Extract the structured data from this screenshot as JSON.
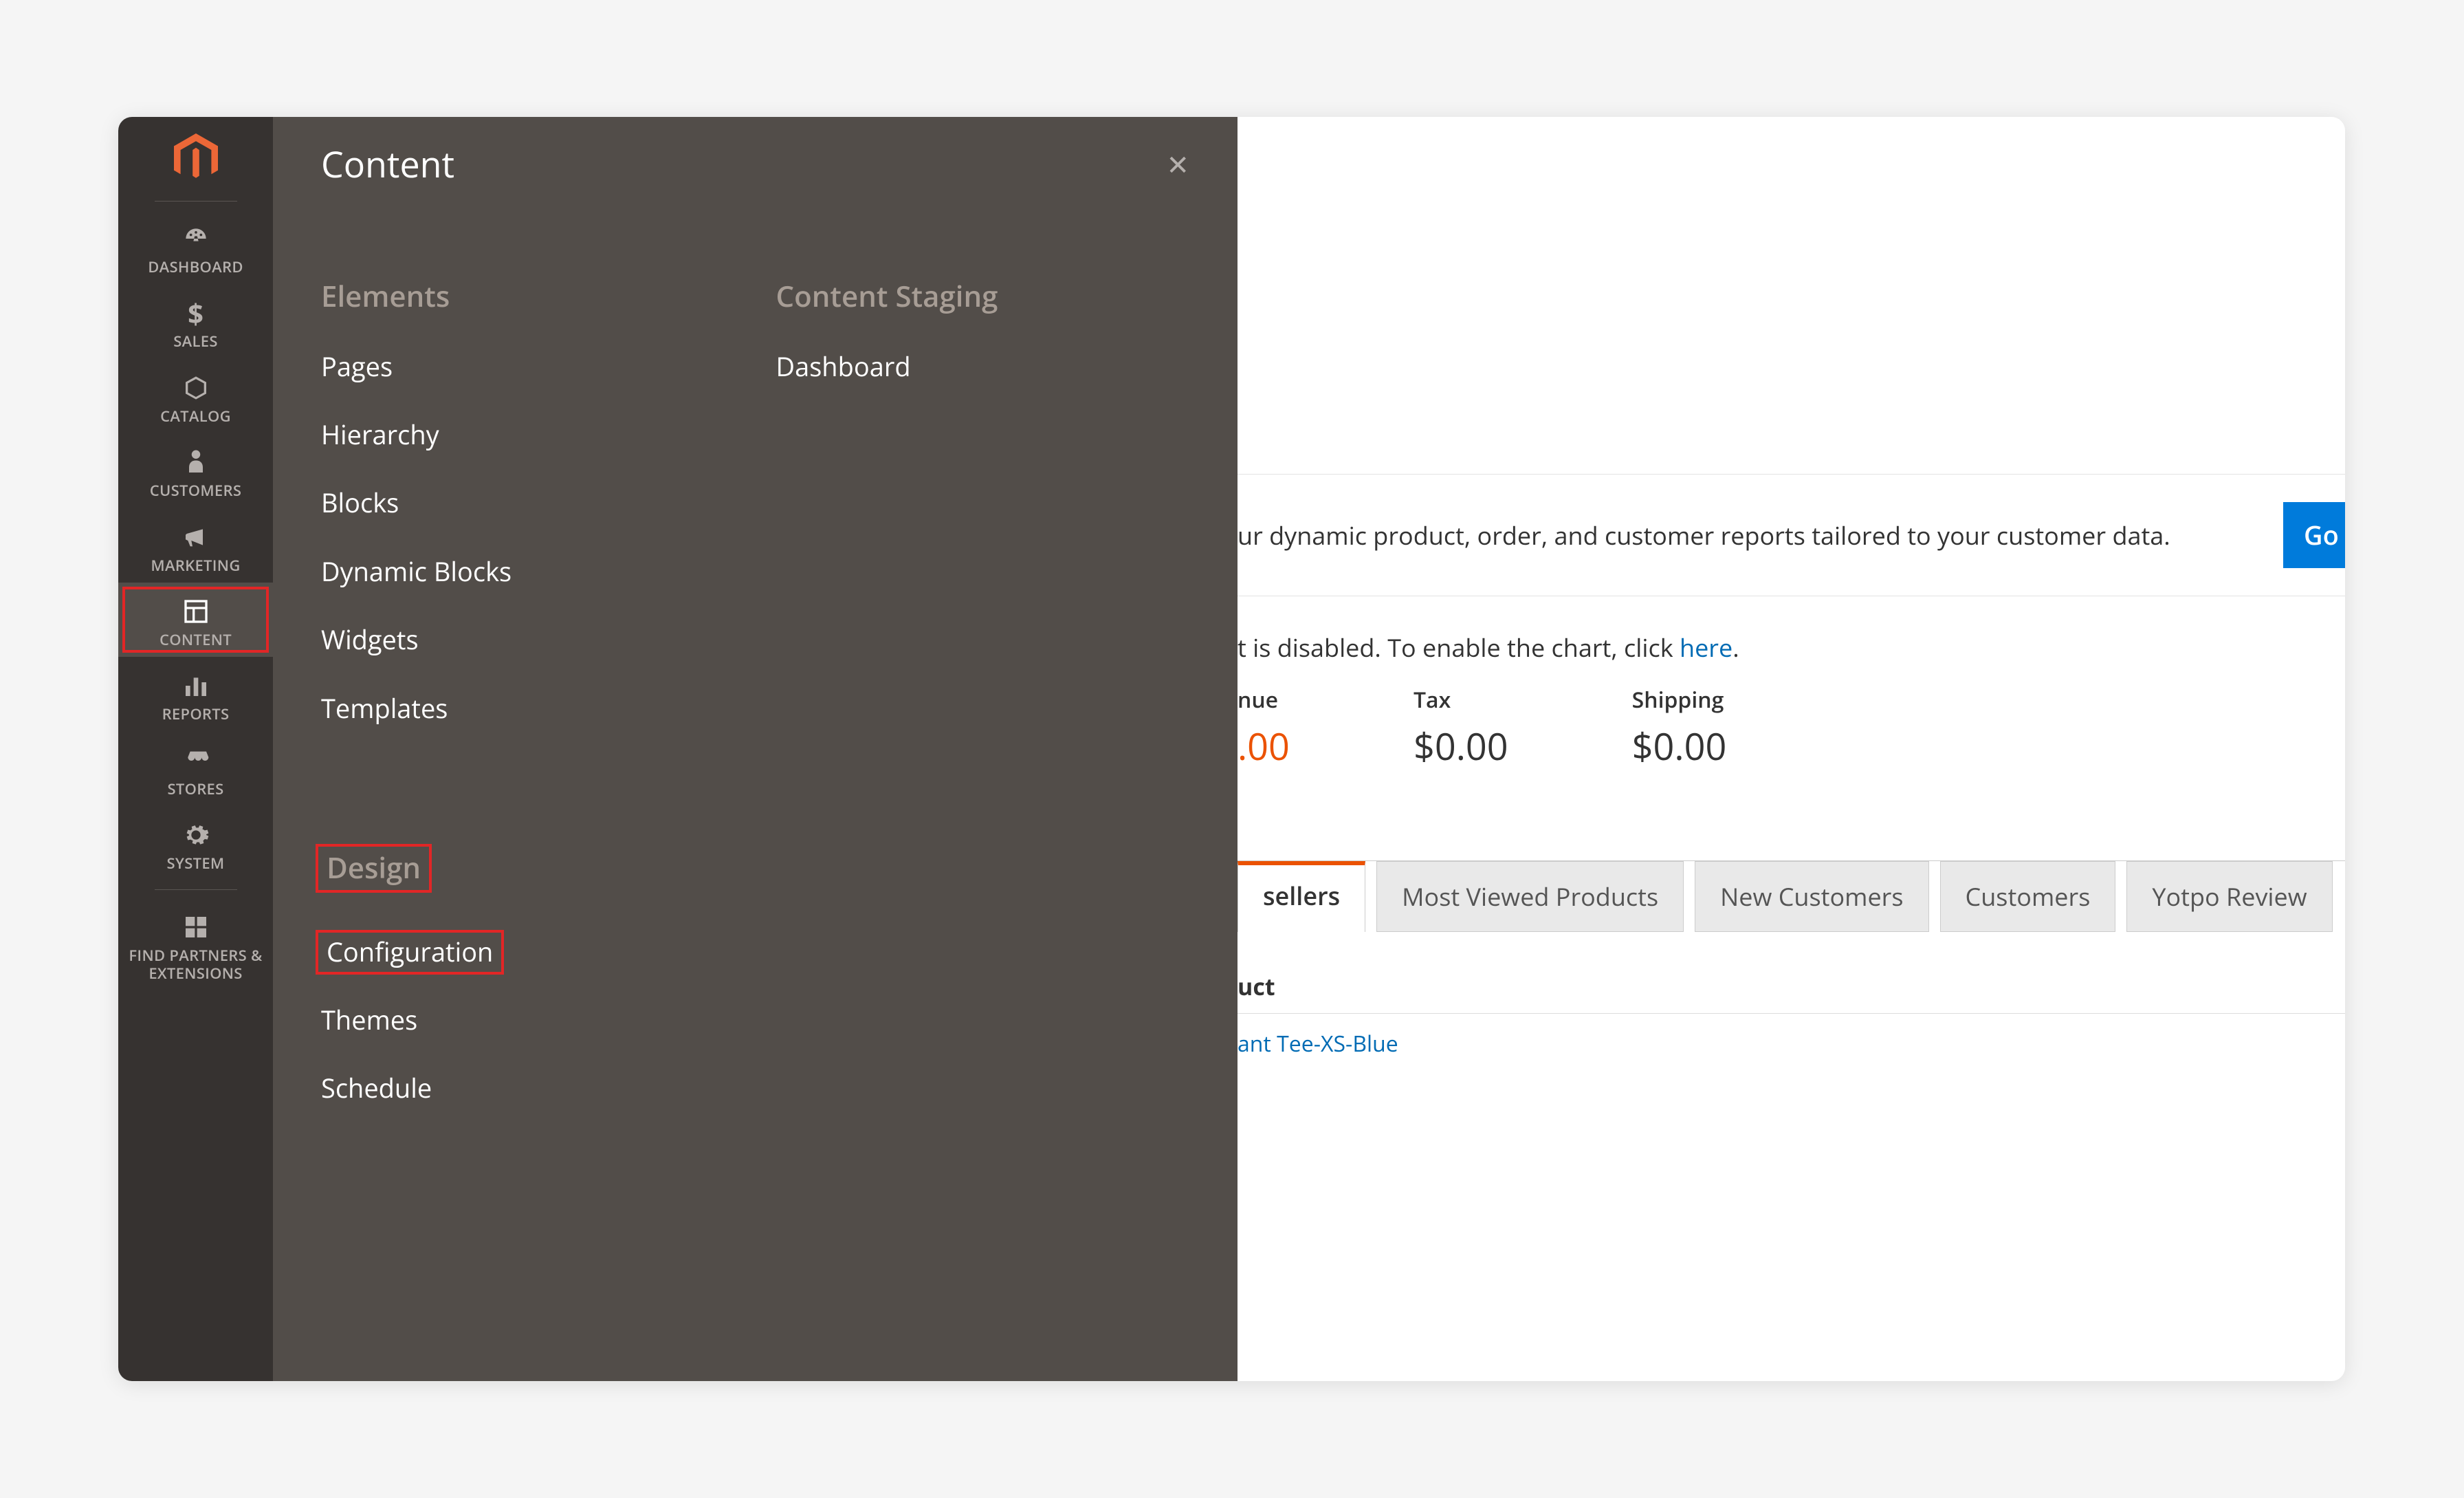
{
  "sidebar": {
    "items": [
      {
        "label": "DASHBOARD",
        "icon": "dashboard"
      },
      {
        "label": "SALES",
        "icon": "dollar"
      },
      {
        "label": "CATALOG",
        "icon": "box"
      },
      {
        "label": "CUSTOMERS",
        "icon": "person"
      },
      {
        "label": "MARKETING",
        "icon": "megaphone"
      },
      {
        "label": "CONTENT",
        "icon": "layout"
      },
      {
        "label": "REPORTS",
        "icon": "bars"
      },
      {
        "label": "STORES",
        "icon": "storefront"
      },
      {
        "label": "SYSTEM",
        "icon": "gear"
      },
      {
        "label": "FIND PARTNERS & EXTENSIONS",
        "icon": "blocks"
      }
    ]
  },
  "flyout": {
    "title": "Content",
    "groups": {
      "elements": {
        "heading": "Elements",
        "items": [
          "Pages",
          "Hierarchy",
          "Blocks",
          "Dynamic Blocks",
          "Widgets",
          "Templates"
        ]
      },
      "design": {
        "heading": "Design",
        "items": [
          "Configuration",
          "Themes",
          "Schedule"
        ]
      },
      "content_staging": {
        "heading": "Content Staging",
        "items": [
          "Dashboard"
        ]
      }
    }
  },
  "main": {
    "bi_text_suffix": "ur dynamic product, order, and customer reports tailored to your customer data.",
    "go_label": "Go",
    "chart_msg_prefix": "t is disabled. To enable the chart, click ",
    "chart_msg_link": "here",
    "chart_msg_suffix": ".",
    "metrics": [
      {
        "label": "nue",
        "value": ".00",
        "accent": true
      },
      {
        "label": "Tax",
        "value": "$0.00",
        "accent": false
      },
      {
        "label": "Shipping",
        "value": "$0.00",
        "accent": false
      }
    ],
    "tabs": [
      "sellers",
      "Most Viewed Products",
      "New Customers",
      "Customers",
      "Yotpo Review"
    ],
    "table": {
      "header": "uct",
      "rows": [
        "ant Tee-XS-Blue"
      ]
    }
  }
}
